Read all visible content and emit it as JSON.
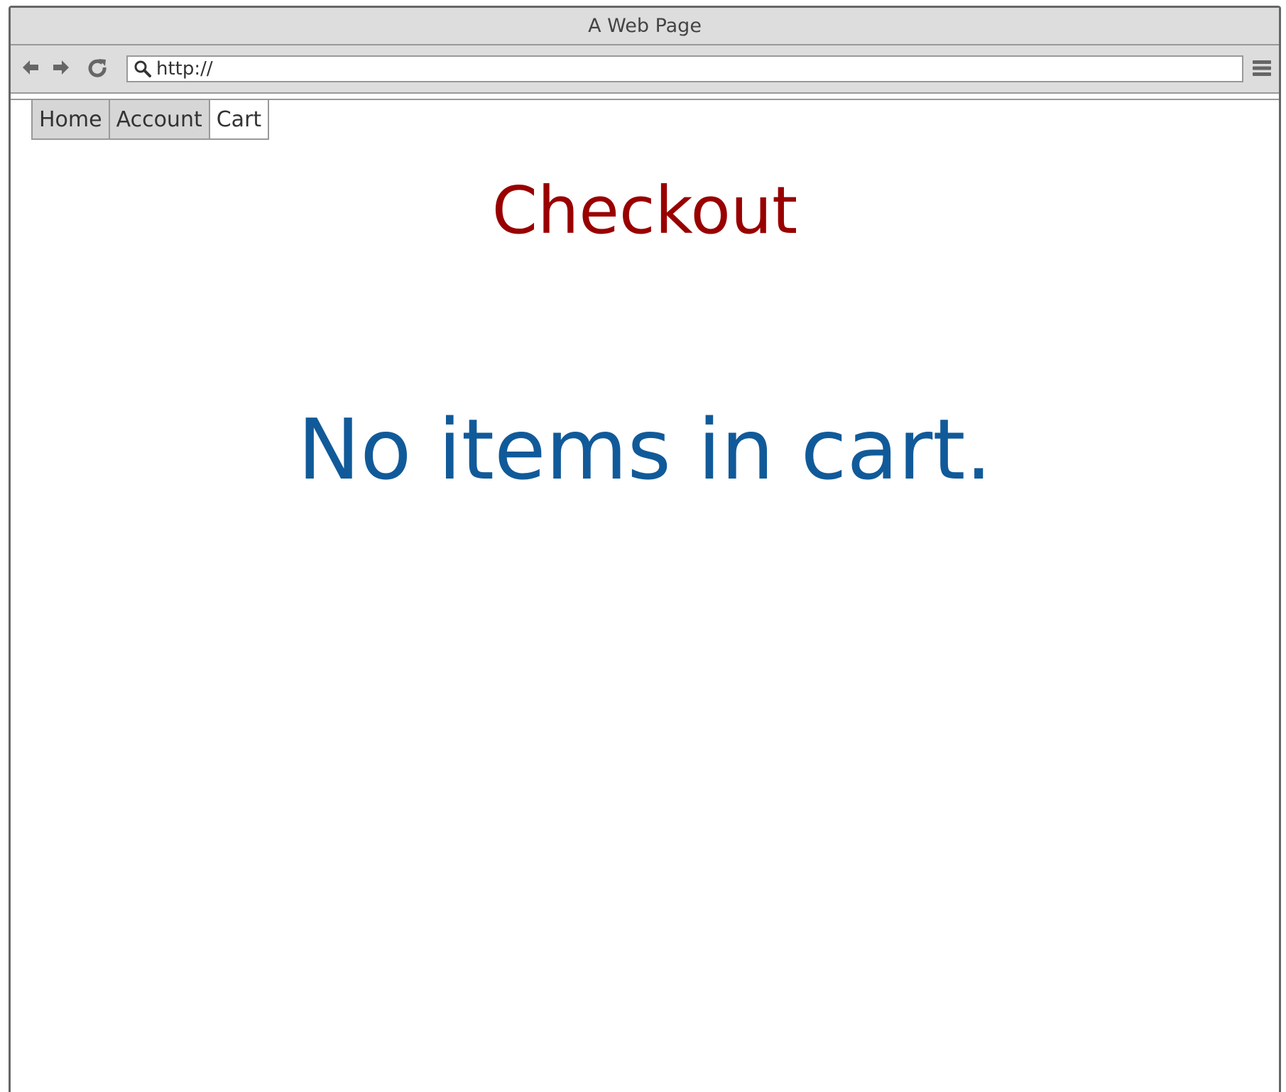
{
  "window": {
    "title": "A Web Page"
  },
  "toolbar": {
    "back_icon": "arrow-left-icon",
    "forward_icon": "arrow-right-icon",
    "reload_icon": "reload-icon",
    "search_icon": "search-icon",
    "url_value": "http://",
    "menu_icon": "hamburger-menu-icon"
  },
  "tabs": [
    {
      "label": "Home",
      "active": false
    },
    {
      "label": "Account",
      "active": false
    },
    {
      "label": "Cart",
      "active": true
    }
  ],
  "main": {
    "title": "Checkout",
    "empty_message": "No items in cart."
  },
  "colors": {
    "title": "#990000",
    "empty_message": "#115a99",
    "chrome": "#dddddd",
    "border": "#999999",
    "icon": "#666666"
  }
}
